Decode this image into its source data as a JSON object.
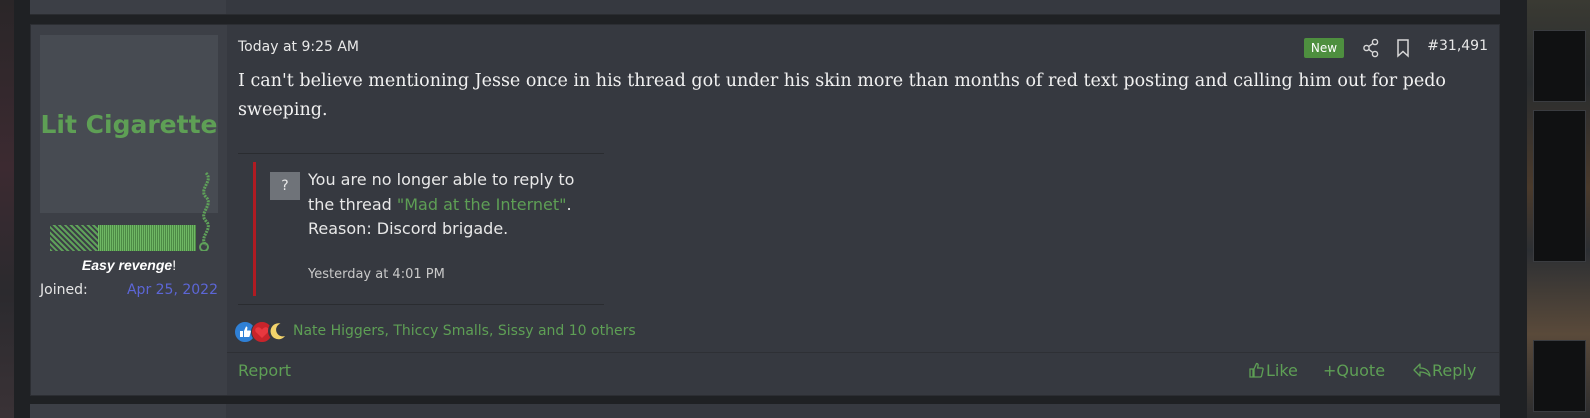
{
  "post": {
    "timestamp": "Today at 9:25 AM",
    "badge": "New",
    "number": "#31,491",
    "message": "I can't believe mentioning Jesse once in his thread got under his skin more than months of red text posting and calling him out for pedo sweeping.",
    "icons": {
      "share": "share-icon",
      "bookmark": "bookmark-icon"
    }
  },
  "user": {
    "avatar_text": "Lit Cigarette",
    "title_prefix": "Easy revenge",
    "title_suffix": "!",
    "joined_label": "Joined:",
    "joined_value": "Apr 25, 2022"
  },
  "embed": {
    "icon_glyph": "?",
    "text_before": "You are no longer able to reply to the thread ",
    "thread_link": "\"Mad at the Internet\"",
    "text_after": ". Reason: Discord brigade.",
    "time": "Yesterday at 4:01 PM"
  },
  "reactions": {
    "icons": [
      "like-reaction-icon",
      "love-reaction-icon",
      "moon-reaction-icon"
    ],
    "names": "Nate Higgers, Thiccy Smalls, Sissy and 10 others"
  },
  "footer": {
    "report": "Report",
    "like": "Like",
    "quote": "Quote",
    "reply": "Reply"
  },
  "colors": {
    "accent_green": "#5e9f55",
    "new_badge": "#4e8f3f",
    "joined_date": "#5c66d6",
    "quote_bar": "#b01b22",
    "post_bg": "#363940",
    "user_bg": "#3c3f46"
  }
}
